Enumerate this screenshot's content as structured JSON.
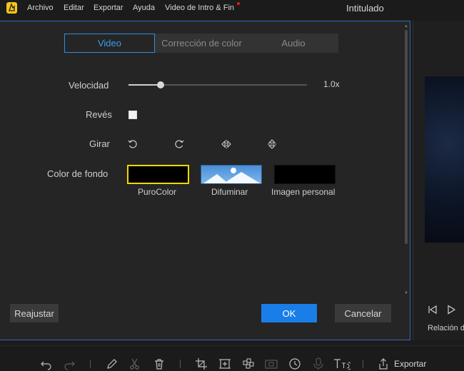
{
  "menubar": {
    "items": [
      "Archivo",
      "Editar",
      "Exportar",
      "Ayuda",
      "Video de Intro & Fin"
    ],
    "window_title": "Intitulado"
  },
  "dialog": {
    "tabs": [
      "Video",
      "Corrección de color",
      "Audio"
    ],
    "active_tab": "Video",
    "speed": {
      "label": "Velocidad",
      "value_text": "1.0x",
      "level": 0.18
    },
    "reverse": {
      "label": "Revés",
      "checked": false
    },
    "rotate": {
      "label": "Girar",
      "icons": [
        "rotate-left-icon",
        "rotate-right-icon",
        "flip-horizontal-icon",
        "flip-vertical-icon"
      ]
    },
    "background": {
      "label": "Color de fondo",
      "options": [
        "PuroColor",
        "Difuminar",
        "Imagen personal"
      ],
      "selected": "PuroColor"
    },
    "buttons": {
      "reset": "Reajustar",
      "ok": "OK",
      "cancel": "Cancelar"
    }
  },
  "preview": {
    "aspect_label": "Relación de"
  },
  "toolbar": {
    "export_label": "Exportar"
  },
  "colors": {
    "accent": "#1a7ee8",
    "selected_border": "#f0d800",
    "tab_active": "#3a9cf0"
  }
}
